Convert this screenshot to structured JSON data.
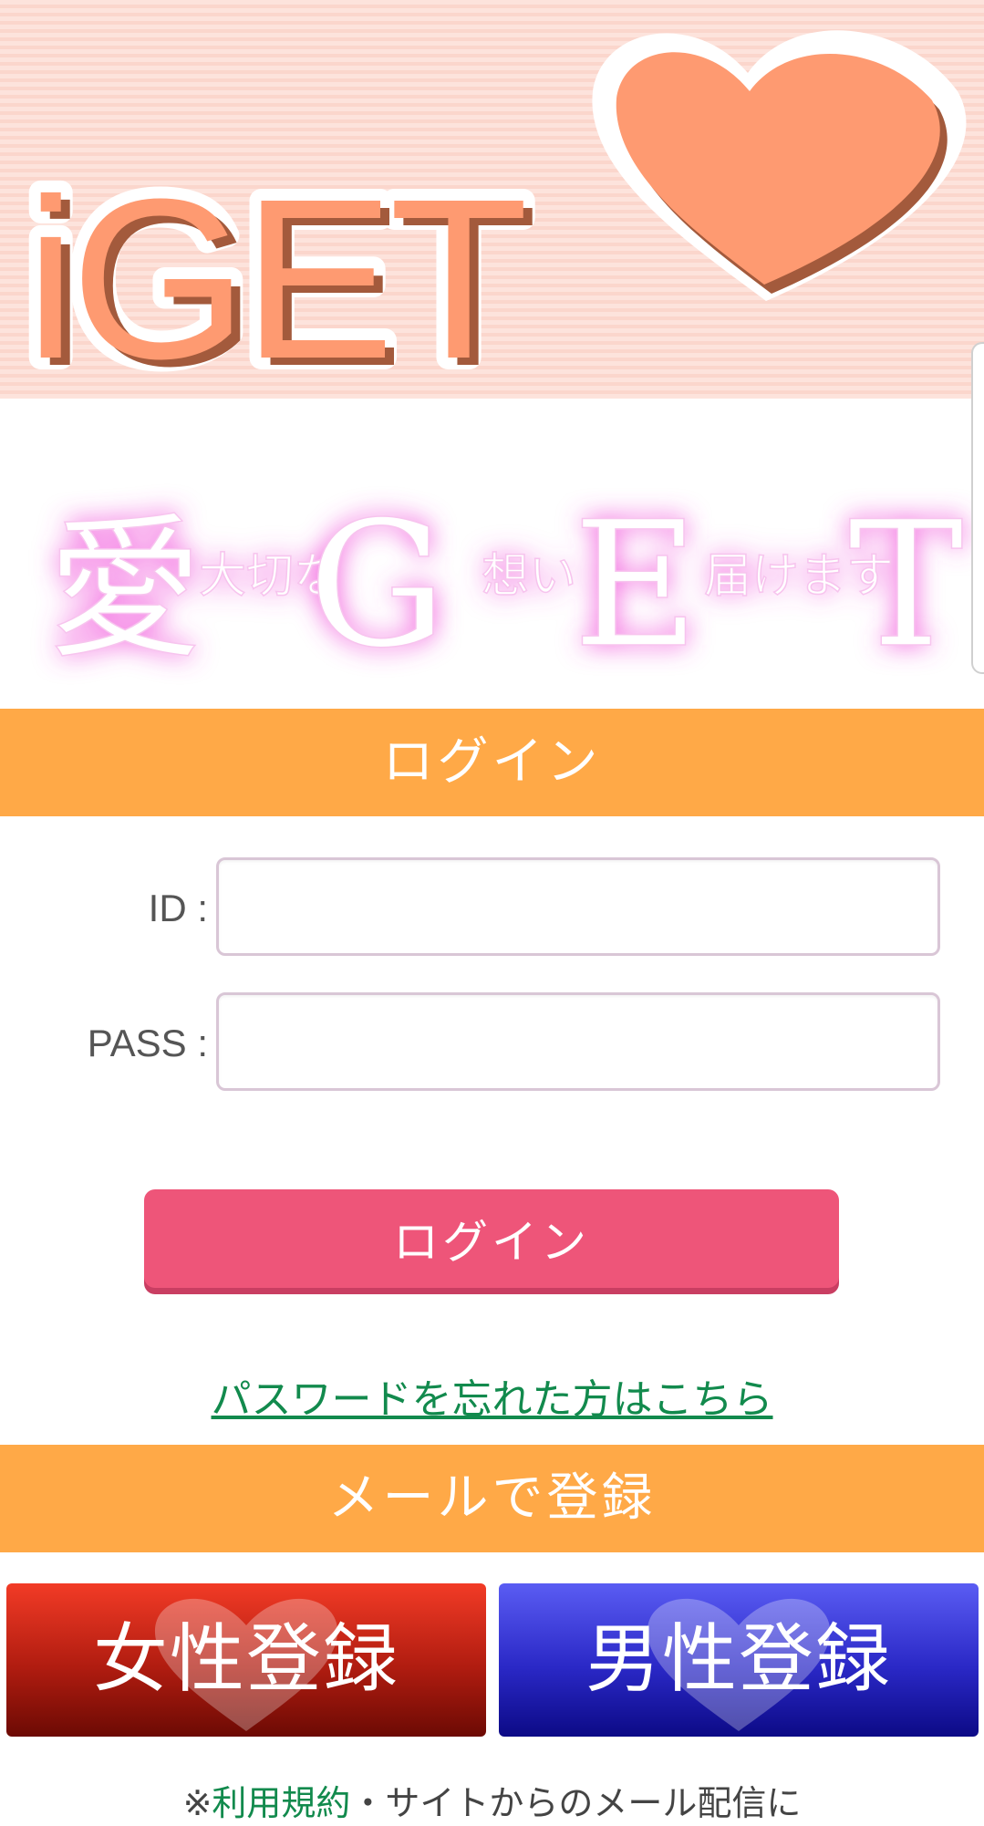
{
  "header": {
    "logo_text": "iGET",
    "tagline": {
      "big1": "愛",
      "small1": "大切な",
      "big2": "G",
      "small2": "想い",
      "big3": "E",
      "small3": "届けます",
      "big4": "T"
    }
  },
  "login_section": {
    "title": "ログイン",
    "id_label": "ID :",
    "pass_label": "PASS :",
    "id_value": "",
    "pass_value": "",
    "submit_label": "ログイン",
    "forgot_link": "パスワードを忘れた方はこちら"
  },
  "mail_section": {
    "title": "メールで登録",
    "female_label": "女性登録",
    "male_label": "男性登録"
  },
  "terms": {
    "prefix": "※",
    "link": "利用規約",
    "suffix": "・サイトからのメール配信に"
  },
  "colors": {
    "accent_orange": "#ffa947",
    "login_pink": "#ee5579",
    "link_green": "#128a4d",
    "heart": "#fe9a71"
  }
}
